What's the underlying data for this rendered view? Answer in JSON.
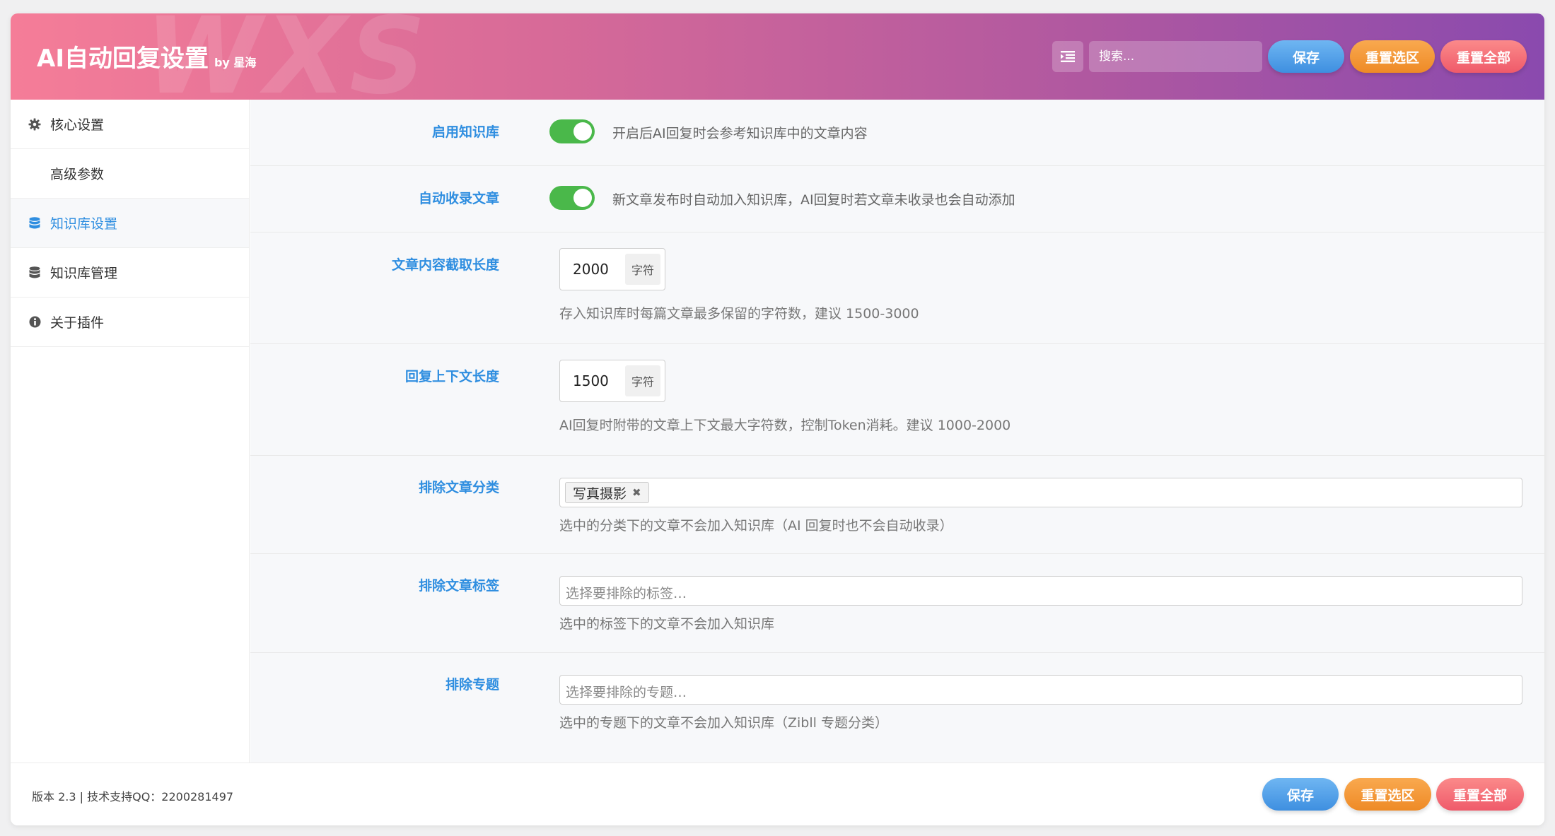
{
  "header": {
    "title": "AI自动回复设置",
    "by": "by 星海",
    "watermark": "WXS",
    "search_placeholder": "搜索...",
    "save_label": "保存",
    "reset_section_label": "重置选区",
    "reset_all_label": "重置全部"
  },
  "sidebar": {
    "items": [
      {
        "label": "核心设置",
        "icon": "gear-icon"
      },
      {
        "label": "高级参数",
        "icon": ""
      },
      {
        "label": "知识库设置",
        "icon": "database-icon",
        "active": true
      },
      {
        "label": "知识库管理",
        "icon": "database-icon"
      },
      {
        "label": "关于插件",
        "icon": "info-icon"
      }
    ]
  },
  "settings": {
    "enable_kb": {
      "label": "启用知识库",
      "enabled": true,
      "desc": "开启后AI回复时会参考知识库中的文章内容"
    },
    "auto_collect": {
      "label": "自动收录文章",
      "enabled": true,
      "desc": "新文章发布时自动加入知识库，AI回复时若文章未收录也会自动添加"
    },
    "content_length": {
      "label": "文章内容截取长度",
      "value": "2000",
      "unit": "字符",
      "desc": "存入知识库时每篇文章最多保留的字符数，建议 1500-3000"
    },
    "context_length": {
      "label": "回复上下文长度",
      "value": "1500",
      "unit": "字符",
      "desc": "AI回复时附带的文章上下文最大字符数，控制Token消耗。建议 1000-2000"
    },
    "exclude_categories": {
      "label": "排除文章分类",
      "selected": [
        "写真摄影"
      ],
      "desc": "选中的分类下的文章不会加入知识库（AI 回复时也不会自动收录）"
    },
    "exclude_tags": {
      "label": "排除文章标签",
      "placeholder": "选择要排除的标签…",
      "desc": "选中的标签下的文章不会加入知识库"
    },
    "exclude_topics": {
      "label": "排除专题",
      "placeholder": "选择要排除的专题…",
      "desc": "选中的专题下的文章不会加入知识库（Zibll 专题分类）"
    }
  },
  "footer": {
    "text": "版本 2.3 | 技术支持QQ：2200281497",
    "save_label": "保存",
    "reset_section_label": "重置选区",
    "reset_all_label": "重置全部"
  },
  "colors": {
    "accent": "#2f8ee0",
    "toggle_on": "#4ab84a",
    "header_start": "#f57d98",
    "header_end": "#8a4aae"
  }
}
